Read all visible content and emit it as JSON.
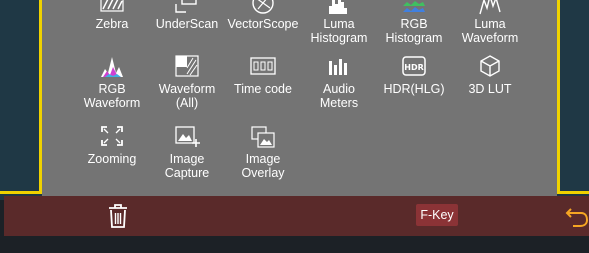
{
  "menu_items": [
    {
      "name": "zebra",
      "label": "Zebra",
      "icon": "zebra-icon"
    },
    {
      "name": "underscan",
      "label": "UnderScan",
      "icon": "underscan-icon"
    },
    {
      "name": "vectorscope",
      "label": "VectorScope",
      "icon": "vectorscope-icon"
    },
    {
      "name": "luma-histogram",
      "label": "Luma\nHistogram",
      "icon": "luma-histogram-icon"
    },
    {
      "name": "rgb-histogram",
      "label": "RGB\nHistogram",
      "icon": "rgb-histogram-icon"
    },
    {
      "name": "luma-waveform",
      "label": "Luma\nWaveform",
      "icon": "luma-waveform-icon"
    },
    {
      "name": "rgb-waveform",
      "label": "RGB\nWaveform",
      "icon": "rgb-waveform-icon"
    },
    {
      "name": "waveform-all",
      "label": "Waveform\n(All)",
      "icon": "waveform-all-icon"
    },
    {
      "name": "time-code",
      "label": "Time code",
      "icon": "time-code-icon"
    },
    {
      "name": "audio-meters",
      "label": "Audio\nMeters",
      "icon": "audio-meters-icon"
    },
    {
      "name": "hdr-hlg",
      "label": "HDR(HLG)",
      "icon": "hdr-icon"
    },
    {
      "name": "3d-lut",
      "label": "3D LUT",
      "icon": "cube-icon"
    },
    {
      "name": "zooming",
      "label": "Zooming",
      "icon": "zoom-corners-icon"
    },
    {
      "name": "image-capture",
      "label": "Image\nCapture",
      "icon": "image-capture-icon"
    },
    {
      "name": "image-overlay",
      "label": "Image\nOverlay",
      "icon": "image-overlay-icon"
    }
  ],
  "footer": {
    "delete_icon": "trash-icon",
    "fkey_label": "F-Key",
    "back_icon": "return-arrow-icon"
  },
  "colors": {
    "panel": "#747474",
    "footer": "#5a2a2a",
    "highlight_border": "#f0d200",
    "fkey_bg": "#8b3336",
    "return_arrow": "#f5a623"
  }
}
